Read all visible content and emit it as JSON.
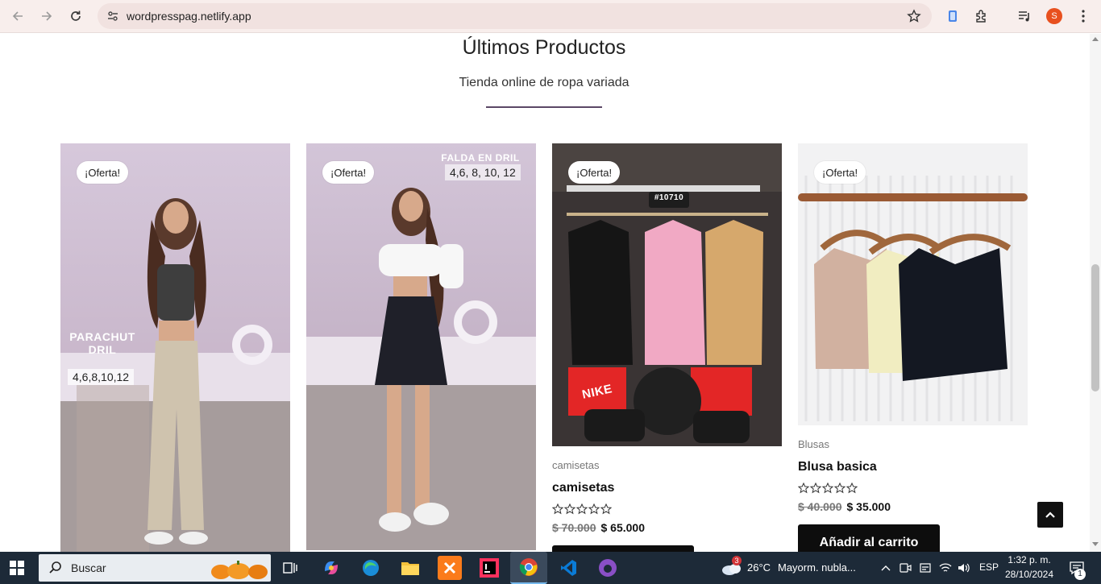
{
  "browser": {
    "url": "wordpresspag.netlify.app",
    "profile_initial": "S"
  },
  "section": {
    "title": "Últimos Productos",
    "subtitle": "Tienda online de ropa variada"
  },
  "products": [
    {
      "badge": "¡Oferta!",
      "image_label": "PARACHUT DRIL",
      "image_sizes": "4,6,8,10,12"
    },
    {
      "badge": "¡Oferta!",
      "image_label": "FALDA EN DRIL",
      "image_sizes": "4,6, 8, 10, 12"
    },
    {
      "badge": "¡Oferta!",
      "image_tag": "#10710",
      "image_brand": "NIKE",
      "category": "camisetas",
      "name": "camisetas",
      "old_price": "$ 70.000",
      "price": "$ 65.000"
    },
    {
      "badge": "¡Oferta!",
      "category": "Blusas",
      "name": "Blusa basica",
      "old_price": "$ 40.000",
      "price": "$ 35.000",
      "cart_label": "Añadir al carrito"
    }
  ],
  "taskbar": {
    "search_placeholder": "Buscar",
    "weather_temp": "26°C",
    "weather_text": "Mayorm. nubla...",
    "weather_badge": "3",
    "language": "ESP",
    "time": "1:32 p. m.",
    "date": "28/10/2024",
    "notification_count": "1"
  },
  "colors": {
    "chrome_bg": "#f8eeec",
    "accent_line": "#5b4766",
    "cart_button": "#0d0d0d",
    "taskbar_bg": "#1d2a38",
    "profile": "#e8501e"
  }
}
